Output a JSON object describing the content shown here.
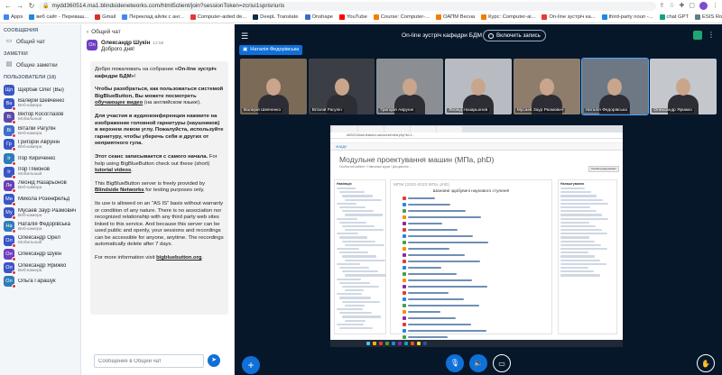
{
  "browser": {
    "url": "mydd360514.ma1.blindsidenetworks.com/html5client/join?sessionToken=zcriui1sprisriuris",
    "bookmarks": [
      {
        "label": "Apps",
        "color": "#4285f4"
      },
      {
        "label": "веб сайт - Переваш...",
        "color": "#1e88e5"
      },
      {
        "label": "Gmail",
        "color": "#d93025"
      },
      {
        "label": "Переклад айлік с анг...",
        "color": "#4285f4"
      },
      {
        "label": "Computer-aided de...",
        "color": "#e53935"
      },
      {
        "label": "DeepL Translate",
        "color": "#0f2b46"
      },
      {
        "label": "Onshape",
        "color": "#3a6ec6"
      },
      {
        "label": "YouTube",
        "color": "#ff0000"
      },
      {
        "label": "Course: Computer-...",
        "color": "#f57c00"
      },
      {
        "label": "ОАПМ Весна",
        "color": "#f57c00"
      },
      {
        "label": "Курс: Computer-ai...",
        "color": "#f57c00"
      },
      {
        "label": "On-line зустріч ка...",
        "color": "#e53935"
      },
      {
        "label": "third-party noun -...",
        "color": "#1e88e5"
      },
      {
        "label": "chat GPT",
        "color": "#10a37f"
      },
      {
        "label": "ESIS Rocky DEM 20...",
        "color": "#607d8b"
      }
    ]
  },
  "left": {
    "messages_header": "СООБЩЕНИЯ",
    "public_chat": "Общий чат",
    "notes_header": "ЗАМЕТКИ",
    "shared_notes": "Общие заметки",
    "users_header": "ПОЛЬЗОВАТЕЛИ (18)",
    "users": [
      {
        "initials": "Щп",
        "name": "Щербак Олег (Вы)",
        "sub": "",
        "color": "#3a56c5"
      },
      {
        "initials": "Ва",
        "name": "Валерій Шевченко",
        "sub": "Веб-камера",
        "color": "#3a56c5"
      },
      {
        "initials": "Ві",
        "name": "Віктор Косоглазов",
        "sub": "Мобильный",
        "color": "#5b4aa8"
      },
      {
        "initials": "Ві",
        "name": "Віталій Рагулін",
        "sub": "Веб-камера",
        "color": "#3f6fc6"
      },
      {
        "initials": "Гр",
        "name": "Григорій Аврунін",
        "sub": "Веб-камера",
        "color": "#3a56c5"
      },
      {
        "initials": "Іг",
        "name": "Ігор Кириченко",
        "sub": "",
        "color": "#2e7db8"
      },
      {
        "initials": "Іг",
        "name": "Ігор Пімонов",
        "sub": "Мобильный",
        "color": "#3a56c5"
      },
      {
        "initials": "Ле",
        "name": "Леонід Назарьонов",
        "sub": "Веб-камера",
        "color": "#6a3fb5"
      },
      {
        "initials": "Ми",
        "name": "Микола Розенфельд",
        "sub": "",
        "color": "#3a56c5"
      },
      {
        "initials": "Му",
        "name": "Мусаев Заур Размович",
        "sub": "Веб-камера",
        "color": "#3a56c5"
      },
      {
        "initials": "На",
        "name": "Наталія Федорівська",
        "sub": "Веб-камера",
        "color": "#2e7db8"
      },
      {
        "initials": "Ол",
        "name": "Олександр Орел",
        "sub": "Мобильный",
        "color": "#3a56c5"
      },
      {
        "initials": "Ол",
        "name": "Олександр Шукін",
        "sub": "",
        "color": "#6e3fbf"
      },
      {
        "initials": "Ол",
        "name": "Олександр Ярижко",
        "sub": "Веб-камера",
        "color": "#3a56c5"
      },
      {
        "initials": "Ол",
        "name": "Ольга Гарашук",
        "sub": "",
        "color": "#2e7db8"
      }
    ]
  },
  "chat": {
    "title": "Общий чат",
    "author": "Олександр Шукін",
    "author_initials": "Ол",
    "time": "12:58",
    "greeting": "Доброго дня!",
    "welcome_paragraphs": [
      {
        "pre": "Добро пожаловать на собрание ",
        "bold": "«On-line зустріч кафедри БДМ»",
        "post": "!"
      },
      {
        "pre": "",
        "bold": "Чтобы разобраться, как пользоваться системой BigBlueButton, Вы можете посмотреть ",
        "link": "обучающее видео",
        "post": " (на английском языке)."
      },
      {
        "pre": "",
        "bold": "Для участия в аудиоконференции нажмите на изображение головной гарнитуры (наушников) в верхнем левом углу. Пожалуйста, используйте гарнитуру, чтобы уберечь себя и других от неприятного гула.",
        "post": ""
      },
      {
        "pre": "",
        "bold": "Этот сеанс записывается с самого начала.",
        "post": " For help using BigBlueButton check out these (short) ",
        "link2": "tutorial videos",
        "post2": "."
      },
      {
        "pre": "This BigBlueButton server is freely provided by ",
        "link": "Blindside Networks",
        "post": " for testing purposes only."
      },
      {
        "pre": "Its use is allowed on an \"AS IS\" basis without warranty or condition of any nature. There is no association nor recognized relationship with any third party web sites linked to this service. And because this server can be used public and openly, your sessions and recordings can be accessible for anyone, anytime. The recordings automatically delete after 7 days.",
        "bold": "",
        "post": ""
      },
      {
        "pre": "For more information visit ",
        "link": "bigbluebutton.org",
        "post": "."
      }
    ],
    "input_placeholder": "Сообщение в Общий чат"
  },
  "conference": {
    "meeting_title": "On-line зустріч кафедри БДМ",
    "record_label": "Включить запись",
    "presenter_chip": "Наталія Федорівська",
    "cameras": [
      {
        "name": "Валерій Шевченко",
        "bg": "#7a6a56",
        "active": false
      },
      {
        "name": "Віталій Рагулін",
        "bg": "#3b3f45",
        "active": false
      },
      {
        "name": "Григорій Аврунін",
        "bg": "#8b8f93",
        "active": false
      },
      {
        "name": "Леонід Назарьонов",
        "bg": "#b8bcc2",
        "active": false
      },
      {
        "name": "Мусаев Заур Размович",
        "bg": "#8f7d6c",
        "active": false
      },
      {
        "name": "Наталія Федорівська",
        "bg": "#6d7884",
        "active": true
      },
      {
        "name": "Олександр Ярижко",
        "bg": "#c4c7cb",
        "active": false
      }
    ]
  },
  "screenshare": {
    "url": "dl2022.khadi.kharkov.ua/course/view.php?id=1...",
    "site_bar": "ХНАДУ",
    "course_title": "Модульне проектування машин (МПа, phD)",
    "breadcrumb": "Особистий кабінет / Навчальні курси / Дисципліни ...",
    "settings_btn": "Режим редагування",
    "nav_header": "Навігація",
    "course_line": "МПМ (2022-2023 МПа, phD)",
    "greeting": "Шановні здобувачі наукового ступеня!",
    "right_header": "Налаштування"
  }
}
